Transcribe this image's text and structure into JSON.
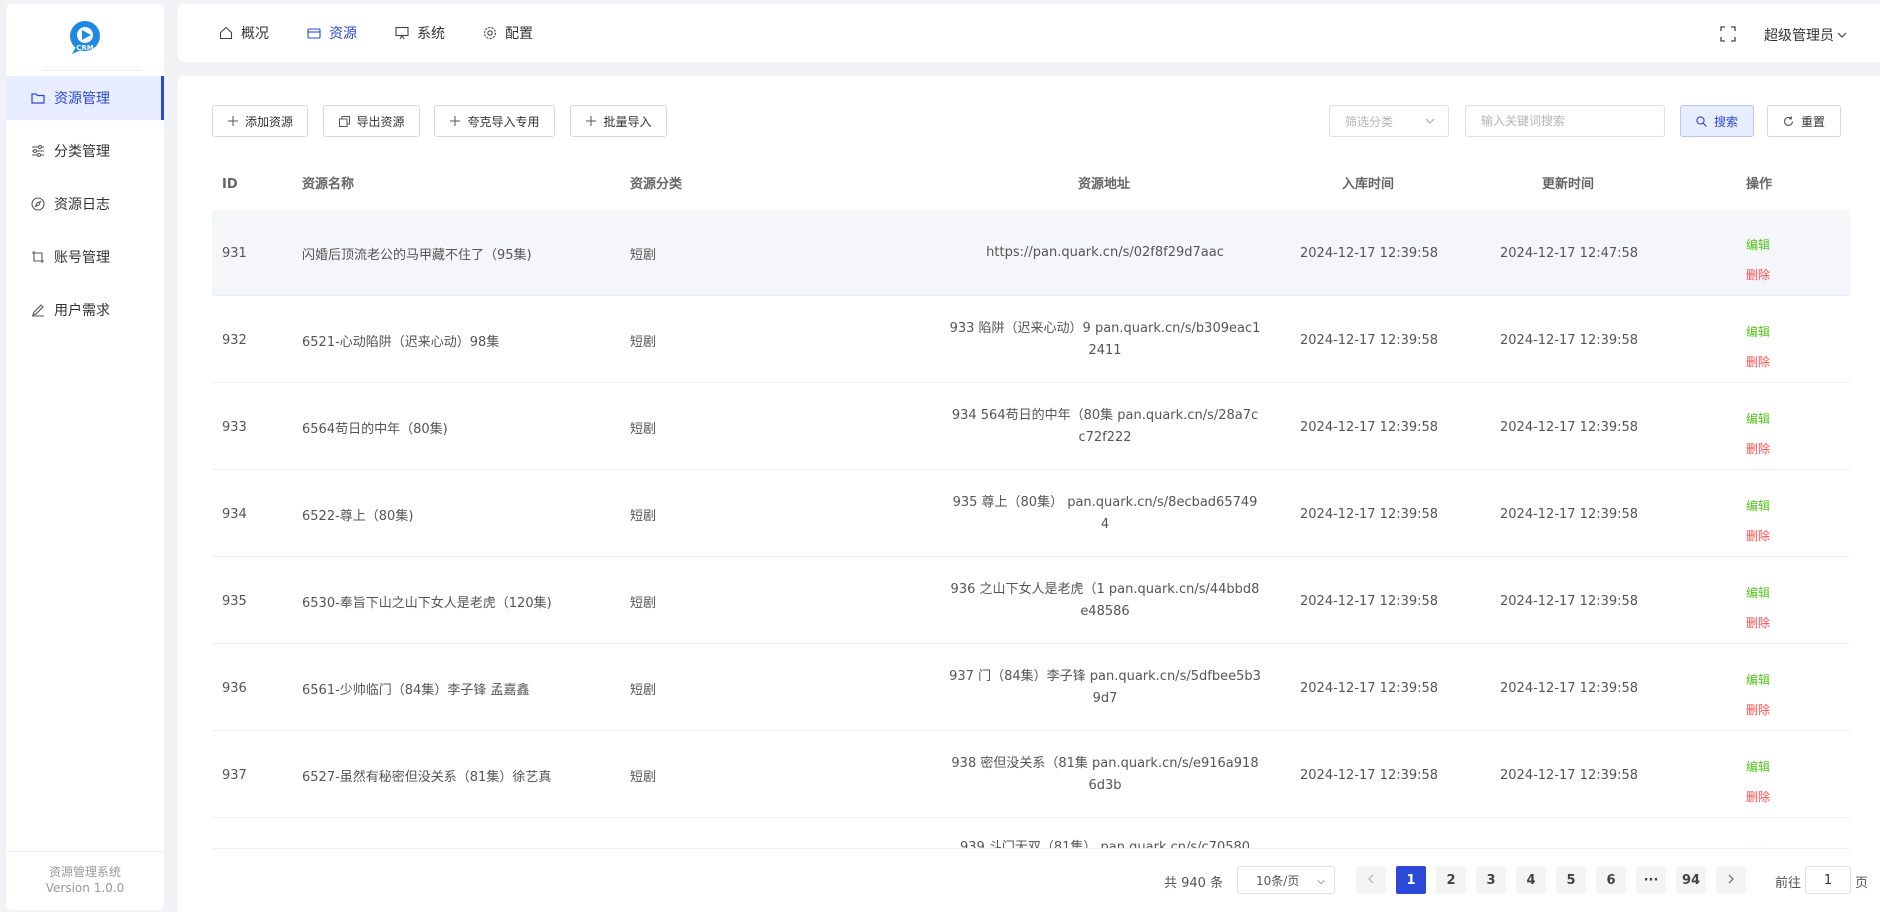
{
  "sidebar": {
    "logo_text": "CRM",
    "items": [
      {
        "label": "资源管理",
        "icon": "folder-icon",
        "active": true
      },
      {
        "label": "分类管理",
        "icon": "sliders-icon",
        "active": false
      },
      {
        "label": "资源日志",
        "icon": "compass-icon",
        "active": false
      },
      {
        "label": "账号管理",
        "icon": "crop-icon",
        "active": false
      },
      {
        "label": "用户需求",
        "icon": "edit-pen-icon",
        "active": false
      }
    ],
    "footer_title": "资源管理系统",
    "footer_version": "Version 1.0.0"
  },
  "topbar": {
    "tabs": [
      {
        "label": "概况",
        "icon": "home-icon"
      },
      {
        "label": "资源",
        "icon": "wallet-icon",
        "active": true
      },
      {
        "label": "系统",
        "icon": "monitor-icon"
      },
      {
        "label": "配置",
        "icon": "gear-icon"
      }
    ],
    "fullscreen_icon": "fullscreen-icon",
    "user_label": "超级管理员"
  },
  "toolbar": {
    "add_label": "添加资源",
    "export_label": "导出资源",
    "quark_import_label": "夸克导入专用",
    "batch_import_label": "批量导入",
    "category_placeholder": "筛选分类",
    "keyword_placeholder": "输入关键词搜索",
    "search_label": "搜索",
    "reset_label": "重置"
  },
  "table": {
    "headers": {
      "id": "ID",
      "name": "资源名称",
      "category": "资源分类",
      "url": "资源地址",
      "created": "入库时间",
      "updated": "更新时间",
      "actions": "操作"
    },
    "edit_label": "编辑",
    "delete_label": "删除",
    "rows": [
      {
        "id": "931",
        "name": "闪婚后顶流老公的马甲藏不住了（95集)",
        "category": "短剧",
        "url": "https://pan.quark.cn/s/02f8f29d7aac",
        "created": "2024-12-17 12:39:58",
        "updated": "2024-12-17 12:47:58"
      },
      {
        "id": "932",
        "name": "6521-心动陷阱（迟来心动）98集",
        "category": "短剧",
        "url": "933 陷阱（迟来心动）9 pan.quark.cn/s/b309eac12411",
        "created": "2024-12-17 12:39:58",
        "updated": "2024-12-17 12:39:58"
      },
      {
        "id": "933",
        "name": "6564苟日的中年（80集)",
        "category": "短剧",
        "url": "934 564苟日的中年（80集 pan.quark.cn/s/28a7cc72f222",
        "created": "2024-12-17 12:39:58",
        "updated": "2024-12-17 12:39:58"
      },
      {
        "id": "934",
        "name": "6522-尊上（80集)",
        "category": "短剧",
        "url": "935 尊上（80集） pan.quark.cn/s/8ecbad657494",
        "created": "2024-12-17 12:39:58",
        "updated": "2024-12-17 12:39:58"
      },
      {
        "id": "935",
        "name": "6530-奉旨下山之山下女人是老虎（120集)",
        "category": "短剧",
        "url": "936 之山下女人是老虎（1 pan.quark.cn/s/44bbd8e48586",
        "created": "2024-12-17 12:39:58",
        "updated": "2024-12-17 12:39:58"
      },
      {
        "id": "936",
        "name": "6561-少帅临门（84集）李子锋 孟嘉鑫",
        "category": "短剧",
        "url": "937 门（84集）李子锋 pan.quark.cn/s/5dfbee5b39d7",
        "created": "2024-12-17 12:39:58",
        "updated": "2024-12-17 12:39:58"
      },
      {
        "id": "937",
        "name": "6527-虽然有秘密但没关系（81集）徐艺真",
        "category": "短剧",
        "url": "938 密但没关系（81集 pan.quark.cn/s/e916a9186d3b",
        "created": "2024-12-17 12:39:58",
        "updated": "2024-12-17 12:39:58"
      },
      {
        "id": "",
        "name": "",
        "category": "",
        "url": "939 斗门无双（81集） pan.quark.cn/s/c70580",
        "created": "",
        "updated": ""
      }
    ]
  },
  "pagination": {
    "total_label": "共 940 条",
    "page_size_label": "10条/页",
    "pages": [
      "1",
      "2",
      "3",
      "4",
      "5",
      "6",
      "···",
      "94"
    ],
    "current": "1",
    "goto_label": "前往",
    "goto_value": "1",
    "page_suffix": "页"
  },
  "colors": {
    "accent": "#2c48d8",
    "edit": "#52c41a",
    "delete": "#ff4d4f"
  }
}
